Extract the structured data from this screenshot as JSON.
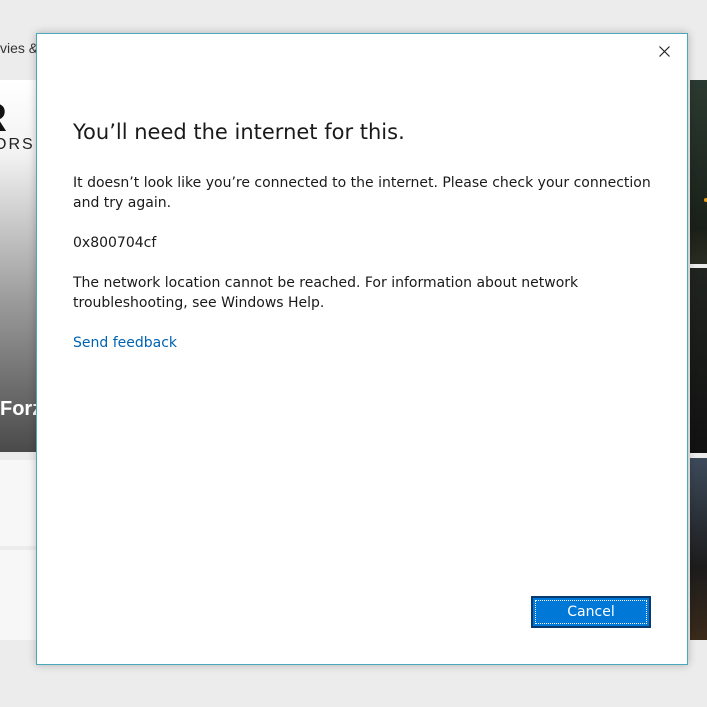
{
  "background": {
    "nav_text": "vies &",
    "hero_logo_big": "R",
    "hero_logo_small": "ORS",
    "hero_title": "Forz"
  },
  "dialog": {
    "title": "You’ll need the internet for this.",
    "message": "It doesn’t look like you’re connected to the internet. Please check your connection and try again.",
    "error_code": "0x800704cf",
    "detail": "The network location cannot be reached. For information about network troubleshooting, see Windows Help.",
    "feedback_link": "Send feedback",
    "cancel_label": "Cancel",
    "close_icon": "close-icon"
  },
  "colors": {
    "accent": "#0078d7",
    "link": "#0063b1",
    "dialog_border": "#4aa8b8"
  }
}
